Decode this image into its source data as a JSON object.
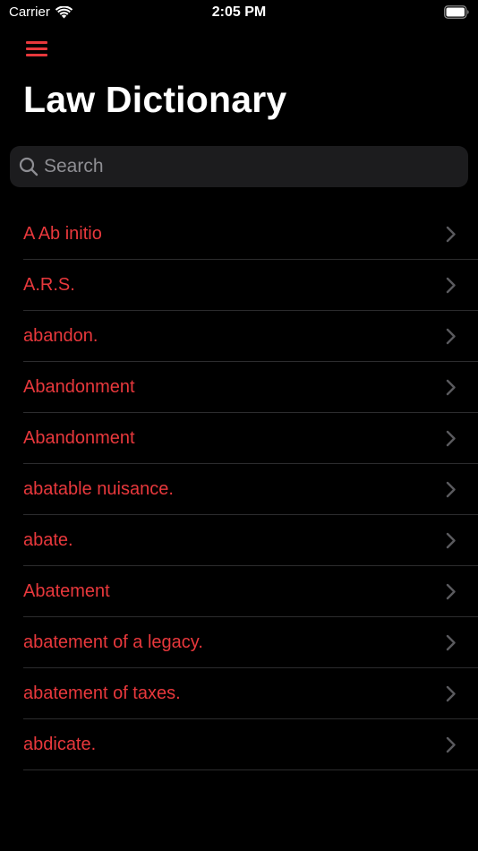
{
  "status_bar": {
    "carrier": "Carrier",
    "time": "2:05 PM",
    "icons": [
      "wifi-icon",
      "battery-icon"
    ]
  },
  "header": {
    "menu_icon": "hamburger-menu-icon",
    "title": "Law Dictionary"
  },
  "search": {
    "placeholder": "Search",
    "value": "",
    "icon": "search-icon"
  },
  "terms": [
    {
      "label": "A Ab initio"
    },
    {
      "label": "A.R.S."
    },
    {
      "label": "abandon."
    },
    {
      "label": "Abandonment"
    },
    {
      "label": "Abandonment"
    },
    {
      "label": "abatable nuisance."
    },
    {
      "label": "abate."
    },
    {
      "label": "Abatement"
    },
    {
      "label": "abatement of a legacy."
    },
    {
      "label": "abatement of taxes."
    },
    {
      "label": "abdicate."
    }
  ],
  "colors": {
    "accent": "#e8383c",
    "background": "#000000",
    "search_background": "#1c1c1e",
    "separator": "#2c2c2e",
    "chevron": "#5a5a5e",
    "placeholder": "#8e8e93"
  }
}
